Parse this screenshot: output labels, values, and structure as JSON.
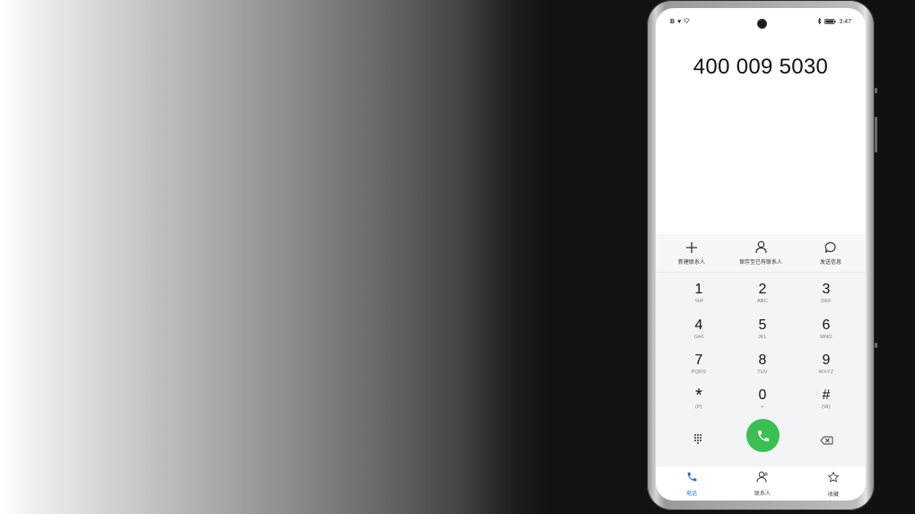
{
  "status_bar": {
    "time": "3:47",
    "left_icons": [
      "b-icon",
      "heart-icon",
      "wifi-icon"
    ],
    "right_icons": [
      "bluetooth-icon",
      "battery-icon"
    ]
  },
  "dialer": {
    "number": "400 009 5030",
    "actions": [
      {
        "label": "新建联系人",
        "icon": "plus-icon"
      },
      {
        "label": "保存至已有联系人",
        "icon": "person-icon"
      },
      {
        "label": "发送信息",
        "icon": "message-icon"
      }
    ],
    "keys": [
      {
        "digit": "1",
        "sub": "voicemail"
      },
      {
        "digit": "2",
        "sub": "ABC"
      },
      {
        "digit": "3",
        "sub": "DEF"
      },
      {
        "digit": "4",
        "sub": "GHI"
      },
      {
        "digit": "5",
        "sub": "JKL"
      },
      {
        "digit": "6",
        "sub": "MNO"
      },
      {
        "digit": "7",
        "sub": "PQRS"
      },
      {
        "digit": "8",
        "sub": "TUV"
      },
      {
        "digit": "9",
        "sub": "WXYZ"
      },
      {
        "digit": "*",
        "sub": "(P)"
      },
      {
        "digit": "0",
        "sub": "+"
      },
      {
        "digit": "#",
        "sub": "(W)"
      }
    ]
  },
  "tabs": [
    {
      "label": "电话",
      "icon": "phone-icon",
      "active": true
    },
    {
      "label": "联系人",
      "icon": "contacts-icon",
      "active": false
    },
    {
      "label": "收藏",
      "icon": "star-icon",
      "active": false
    }
  ],
  "colors": {
    "call_green": "#3cbf52",
    "active_blue": "#1d6fe0"
  }
}
